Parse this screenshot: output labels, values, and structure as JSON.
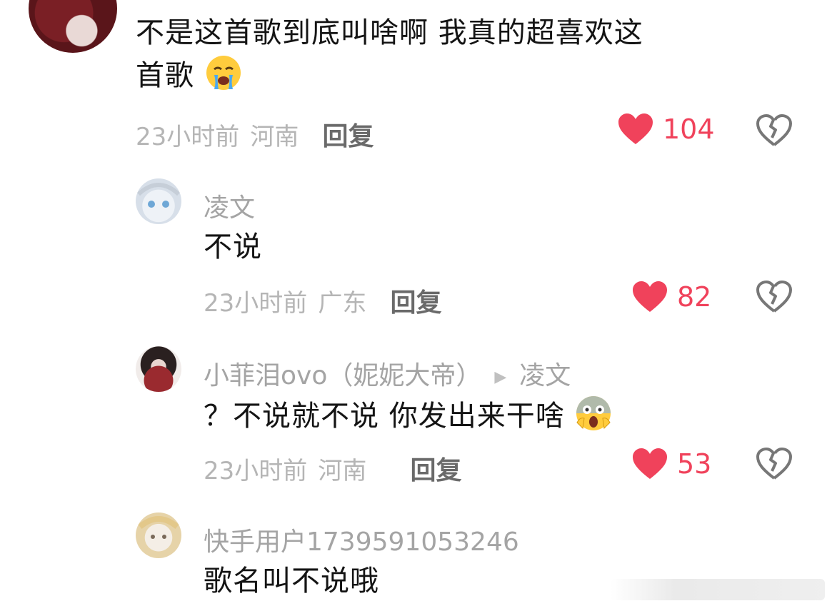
{
  "comments": [
    {
      "body_line1": "不是这首歌到底叫啥啊  我真的超喜欢这",
      "body_line2": "首歌",
      "emoji_icon": "loudly-crying-face-emoji",
      "time": "23小时前",
      "location": "河南",
      "reply_label": "回复",
      "likes": "104"
    },
    {
      "username": "凌文",
      "body": "不说",
      "time": "23小时前",
      "location": "广东",
      "reply_label": "回复",
      "likes": "82"
    },
    {
      "username": "小菲泪ovo（妮妮大帝）",
      "reply_to": "凌文",
      "body": "？不说就不说 你发出来干啥",
      "emoji_icon": "face-screaming-in-fear-emoji",
      "time": "23小时前",
      "location": "河南",
      "reply_label": "回复",
      "likes": "53"
    },
    {
      "username": "快手用户1739591053246",
      "body": "歌名叫不说哦"
    }
  ],
  "colors": {
    "like_heart": "#f0425b",
    "meta_gray": "#b5b5b5",
    "username_gray": "#a4a4a4"
  }
}
